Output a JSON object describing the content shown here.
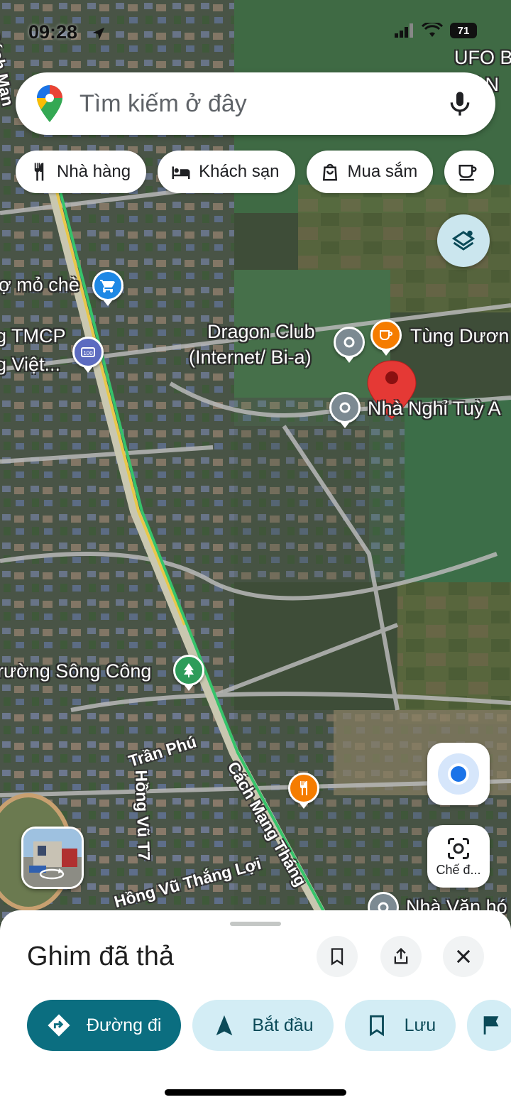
{
  "status": {
    "time": "09:28",
    "battery": "71"
  },
  "search": {
    "placeholder": "Tìm kiếm ở đây"
  },
  "chips": [
    "Nhà hàng",
    "Khách sạn",
    "Mua sắm"
  ],
  "map": {
    "labels": {
      "ufo": "UFO B",
      "ufo2": "i N",
      "cho_mo_che": "ợ mỏ chè",
      "bank1": "g TMCP",
      "bank2": "g Việt...",
      "dragon1": "Dragon Club",
      "dragon2": "(Internet/ Bi-a)",
      "tung_duong": "Tùng Dươn",
      "nha_nghi": "Nhà Nghỉ Tuỳ A",
      "truong_song_cong": "rường Sông Công",
      "nha_van_hoa": "Nhà Văn hó"
    },
    "streets": {
      "cach_mang_top": "Cách Mạn",
      "tran_phu": "Trần Phú",
      "hong_vu_t7": "Hồng Vũ T7",
      "cach_mang_thang": "Cách Mạng Tháng",
      "hong_vu_thang_loi": "Hồng Vũ Thắng Lợi"
    },
    "accent_colors": {
      "pin": "#e53935",
      "poi_blue": "#1e88e5",
      "poi_orange": "#f57c00",
      "poi_green": "#2e9c5a",
      "poi_gray": "#7c8a92"
    }
  },
  "lens": {
    "label": "Chế đ..."
  },
  "sheet": {
    "title": "Ghim đã thả",
    "actions": [
      "Đường đi",
      "Bắt đầu",
      "Lưu"
    ]
  }
}
